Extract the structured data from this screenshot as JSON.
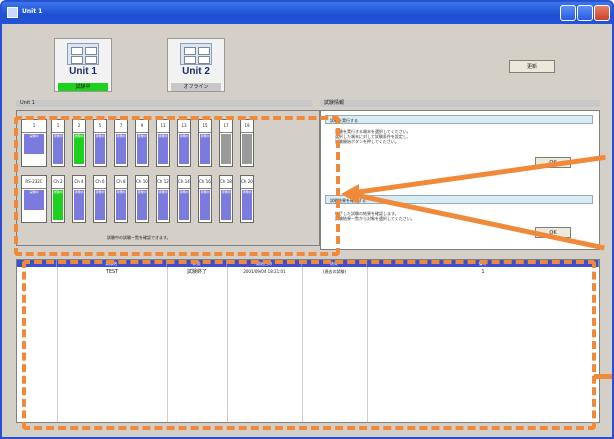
{
  "window": {
    "title": "Unit 1",
    "controls": [
      "minimize",
      "maximize",
      "close"
    ]
  },
  "units": [
    {
      "name": "Unit 1",
      "status": "試験中",
      "status_color": "#1fd11f"
    },
    {
      "name": "Unit 2",
      "status": "オフライン",
      "status_color": "#c8c8c8"
    }
  ],
  "toolbar": {
    "refresh_label": "更新"
  },
  "left_section": {
    "header": "Unit 1",
    "row1_label": {
      "top": "1",
      "body": "実験中"
    },
    "row1_slots": [
      {
        "n": "1",
        "state": "待機中",
        "color": "#7b7bdd"
      },
      {
        "n": "2",
        "state": "試験中",
        "color": "#1fd11f"
      },
      {
        "n": "5",
        "state": "待機中",
        "color": "#7b7bdd"
      },
      {
        "n": "7",
        "state": "待機中",
        "color": "#7b7bdd"
      },
      {
        "n": "9",
        "state": "待機中",
        "color": "#7b7bdd"
      },
      {
        "n": "11",
        "state": "待機中",
        "color": "#7b7bdd"
      },
      {
        "n": "13",
        "state": "待機中",
        "color": "#7b7bdd"
      },
      {
        "n": "15",
        "state": "待機中",
        "color": "#7b7bdd"
      },
      {
        "n": "17",
        "state": "",
        "color": "#9a9a9a"
      },
      {
        "n": "19",
        "state": "",
        "color": "#9a9a9a"
      }
    ],
    "row2_label": {
      "top": "RS-232C",
      "body": "実験中"
    },
    "row2_slots": [
      {
        "n": "Ch 2",
        "state": "試験中",
        "color": "#1fd11f"
      },
      {
        "n": "Ch 4",
        "state": "待機中",
        "color": "#7b7bdd"
      },
      {
        "n": "Ch 6",
        "state": "待機中",
        "color": "#7b7bdd"
      },
      {
        "n": "Ch 8",
        "state": "待機中",
        "color": "#7b7bdd"
      },
      {
        "n": "Ch 10",
        "state": "待機中",
        "color": "#7b7bdd"
      },
      {
        "n": "Ch 12",
        "state": "待機中",
        "color": "#7b7bdd"
      },
      {
        "n": "Ch 14",
        "state": "待機中",
        "color": "#7b7bdd"
      },
      {
        "n": "Ch 16",
        "state": "待機中",
        "color": "#7b7bdd"
      },
      {
        "n": "Ch 18",
        "state": "待機中",
        "color": "#7b7bdd"
      },
      {
        "n": "Ch 20",
        "state": "待機中",
        "color": "#7b7bdd"
      }
    ],
    "footer_note": "試験中の試験一覧を確認できます。"
  },
  "right_section": {
    "header": "試験情報",
    "box1_title": "試験を実行する",
    "box1_lines": [
      "試験を実行する端末を選択してください。",
      "選択した端末に対して試験条件を設定し、",
      "試験開始ボタンを押してください。"
    ],
    "box1_ok": "OK",
    "box2_title": "試験結果を確認する",
    "box2_lines": [
      "終了した試験の結果を確認します。",
      "試験結果一覧から対象を選択してください。"
    ],
    "box2_ok": "OK"
  },
  "table": {
    "columns": [
      "",
      "試験名",
      "状態",
      "開始日時",
      "結果",
      "備考"
    ],
    "rows": [
      {
        "c1": "TEST",
        "c2": "試験終了",
        "c3": "2001/09/04 18:21:01",
        "c4": "(過去の試験)",
        "c5": "1"
      }
    ]
  }
}
